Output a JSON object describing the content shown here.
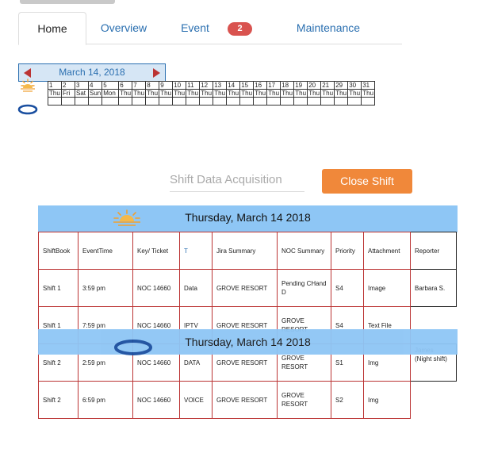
{
  "tabs": [
    {
      "label": "Home",
      "active": true
    },
    {
      "label": "Overview"
    },
    {
      "label": "Event",
      "badge": "2"
    },
    {
      "label": "Maintenance"
    }
  ],
  "date_nav": {
    "label": "March 14, 2018"
  },
  "calendar": {
    "days": [
      "1",
      "2",
      "3",
      "4",
      "5",
      "6",
      "7",
      "8",
      "9",
      "10",
      "11",
      "12",
      "13",
      "14",
      "15",
      "16",
      "17",
      "18",
      "19",
      "20",
      "21",
      "29",
      "30",
      "31"
    ],
    "weekdays": [
      "Thu",
      "Fri",
      "Sat",
      "Sun",
      "Mon",
      "Thu",
      "Thu",
      "Thu",
      "Thu",
      "Thu",
      "Thu",
      "Thu",
      "Thu",
      "Thu",
      "Thu",
      "Thu",
      "Thu",
      "Thu",
      "Thu",
      "Thu",
      "Thu",
      "Thu",
      "Thu",
      "Thu"
    ]
  },
  "shift": {
    "field_placeholder": "Shift Data Acquisition",
    "close_label": "Close Shift"
  },
  "day_header": "Thursday, March 14 2018",
  "overlay_header": "Thursday, March 14 2018",
  "columns": [
    "ShiftBook",
    "EventTime",
    "Key/ Ticket",
    "T",
    "Jira Summary",
    "NOC Summary",
    "Priority",
    "Attachment",
    "Reporter"
  ],
  "rows": [
    [
      "Shift 1",
      "3:59 pm",
      "NOC 14660",
      "Data",
      "GROVE RESORT",
      "Pending CHand D",
      "S4",
      "Image",
      "Barbara S."
    ],
    [
      "Shift 1",
      "7:59 pm",
      "NOC 14660",
      "IPTV",
      "GROVE RESORT",
      "GROVE RESORT",
      "S4",
      "Text File",
      ""
    ],
    [
      "Shift 2",
      "2:59 pm",
      "NOC 14660",
      "DATA",
      "GROVE RESORT",
      "GROVE RESORT",
      "S1",
      "Img",
      "James (Night shift)"
    ],
    [
      "Shift 2",
      "6:59 pm",
      "NOC 14660",
      "VOICE",
      "GROVE RESORT",
      "GROVE RESORT",
      "S2",
      "Img",
      ""
    ]
  ],
  "colors": {
    "accent": "#2a6fb0",
    "header_blue": "#8ec6f5",
    "close_orange": "#f0883a",
    "badge_red": "#d9534f",
    "grid_red": "#b33333"
  },
  "icons": {
    "day": "sun-icon",
    "night": "cloud-icon"
  }
}
